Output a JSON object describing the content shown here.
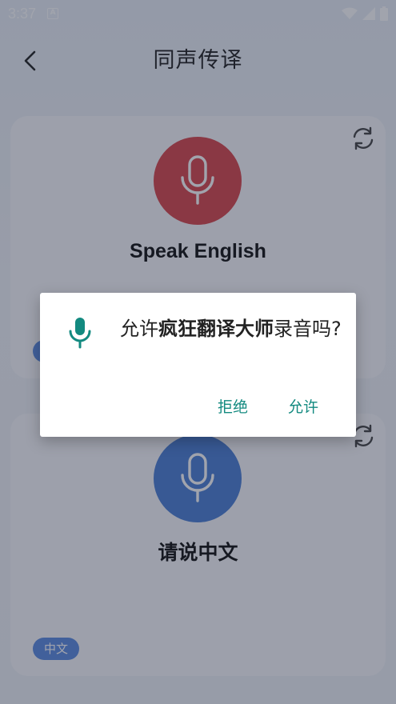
{
  "status_bar": {
    "time": "3:37",
    "notif_glyph": "A"
  },
  "header": {
    "title": "同声传译"
  },
  "card_english": {
    "prompt": "Speak English",
    "lang_label": ""
  },
  "card_chinese": {
    "prompt": "请说中文",
    "lang_label": "中文"
  },
  "dialog": {
    "msg_prefix": "允许",
    "app_name": "疯狂翻译大师",
    "msg_suffix": "录音吗?",
    "deny_label": "拒绝",
    "allow_label": "允许"
  },
  "colors": {
    "accent_teal": "#138a80",
    "mic_red": "#d8454a",
    "mic_blue": "#4a7fd4",
    "badge_blue": "#5b8be0"
  }
}
